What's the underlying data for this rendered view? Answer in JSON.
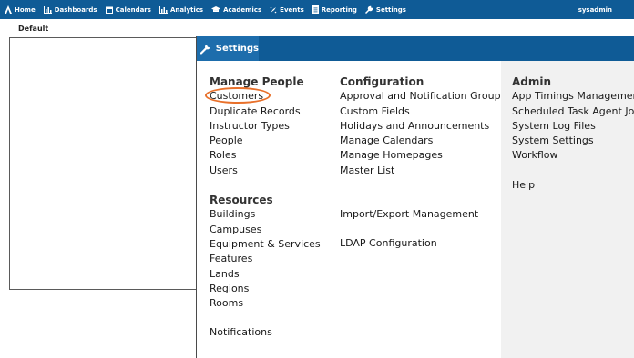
{
  "topnav": {
    "items": [
      {
        "label": "Home",
        "icon": "home-icon"
      },
      {
        "label": "Dashboards",
        "icon": "dashboard-icon"
      },
      {
        "label": "Calendars",
        "icon": "calendar-icon"
      },
      {
        "label": "Analytics",
        "icon": "analytics-icon"
      },
      {
        "label": "Academics",
        "icon": "academics-icon"
      },
      {
        "label": "Events",
        "icon": "events-icon"
      },
      {
        "label": "Reporting",
        "icon": "reporting-icon"
      },
      {
        "label": "Settings",
        "icon": "wrench-icon"
      }
    ],
    "user": "sysadmin"
  },
  "page": {
    "default_label": "Default"
  },
  "settings": {
    "tab_label": "Settings",
    "columns": [
      {
        "groups": [
          {
            "heading": "Manage People",
            "items": [
              "Customers",
              "Duplicate Records",
              "Instructor Types",
              "People",
              "Roles",
              "Users"
            ]
          },
          {
            "heading": "Resources",
            "items": [
              "Buildings",
              "Campuses",
              "Equipment & Services",
              "Features",
              "Lands",
              "Regions",
              "Rooms"
            ]
          },
          {
            "heading": "",
            "items": [
              "Notifications"
            ]
          }
        ]
      },
      {
        "groups": [
          {
            "heading": "Configuration",
            "items": [
              "Approval and Notification Groups",
              "Custom Fields",
              "Holidays and Announcements",
              "Manage Calendars",
              "Manage Homepages",
              "Master List"
            ]
          },
          {
            "heading": "",
            "items": [
              "Import/Export Management"
            ]
          },
          {
            "heading": "",
            "items": [
              "LDAP Configuration"
            ]
          }
        ]
      },
      {
        "groups": [
          {
            "heading": "Admin",
            "items": [
              "App Timings Management",
              "Scheduled Task Agent Jobs",
              "System Log Files",
              "System Settings",
              "Workflow"
            ]
          },
          {
            "heading": "",
            "items": [
              "Help"
            ]
          }
        ]
      }
    ],
    "highlighted_item": "Customers",
    "highlight_color": "#e8702a"
  },
  "colors": {
    "nav_bg": "#0f5b96",
    "tab_bg": "#1d6dac",
    "admin_col_bg": "#f1f1f1"
  }
}
